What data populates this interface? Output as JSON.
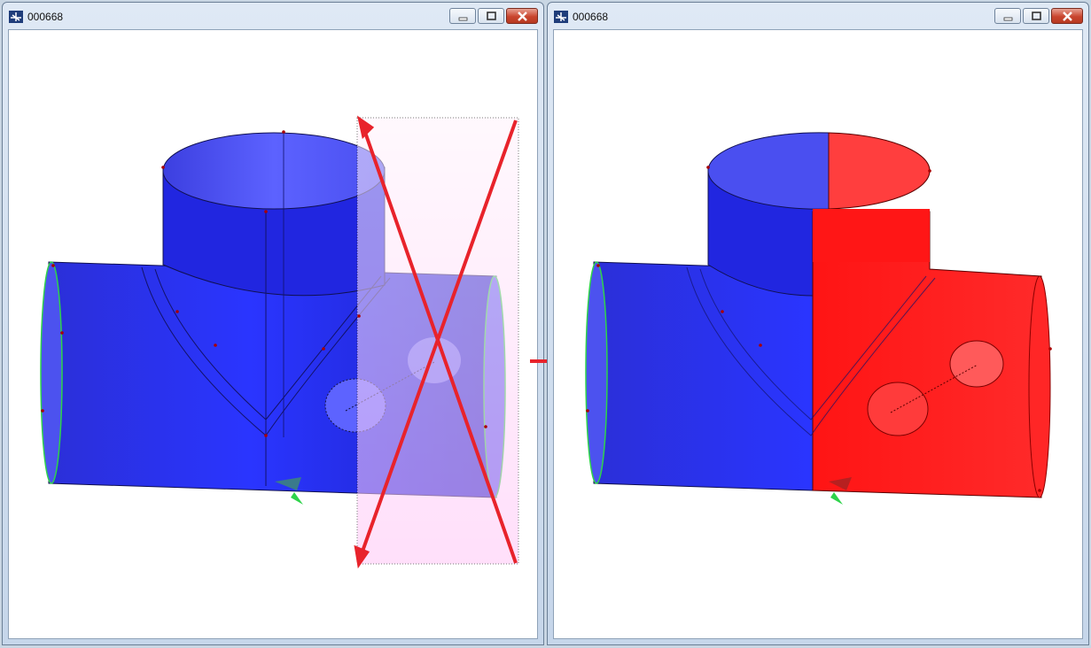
{
  "windows": [
    {
      "title": "000668",
      "buttons": {
        "minimize": "minimize-icon",
        "maximize": "maximize-icon",
        "close": "close-icon"
      }
    },
    {
      "title": "000668",
      "buttons": {
        "minimize": "minimize-icon",
        "maximize": "maximize-icon",
        "close": "close-icon"
      }
    }
  ],
  "icons": {
    "app": "app-logo-icon",
    "transition_arrow": "arrow-right-icon",
    "cross_mark": "cross-out-icon"
  },
  "colors": {
    "model_blue": "#2a2cf0",
    "model_red": "#ff1a1a",
    "selection_fill": "#ffc6f7",
    "annotation_red": "#e8232b",
    "axis_green": "#2ed34a",
    "titlebar": "#d4e1f0"
  }
}
